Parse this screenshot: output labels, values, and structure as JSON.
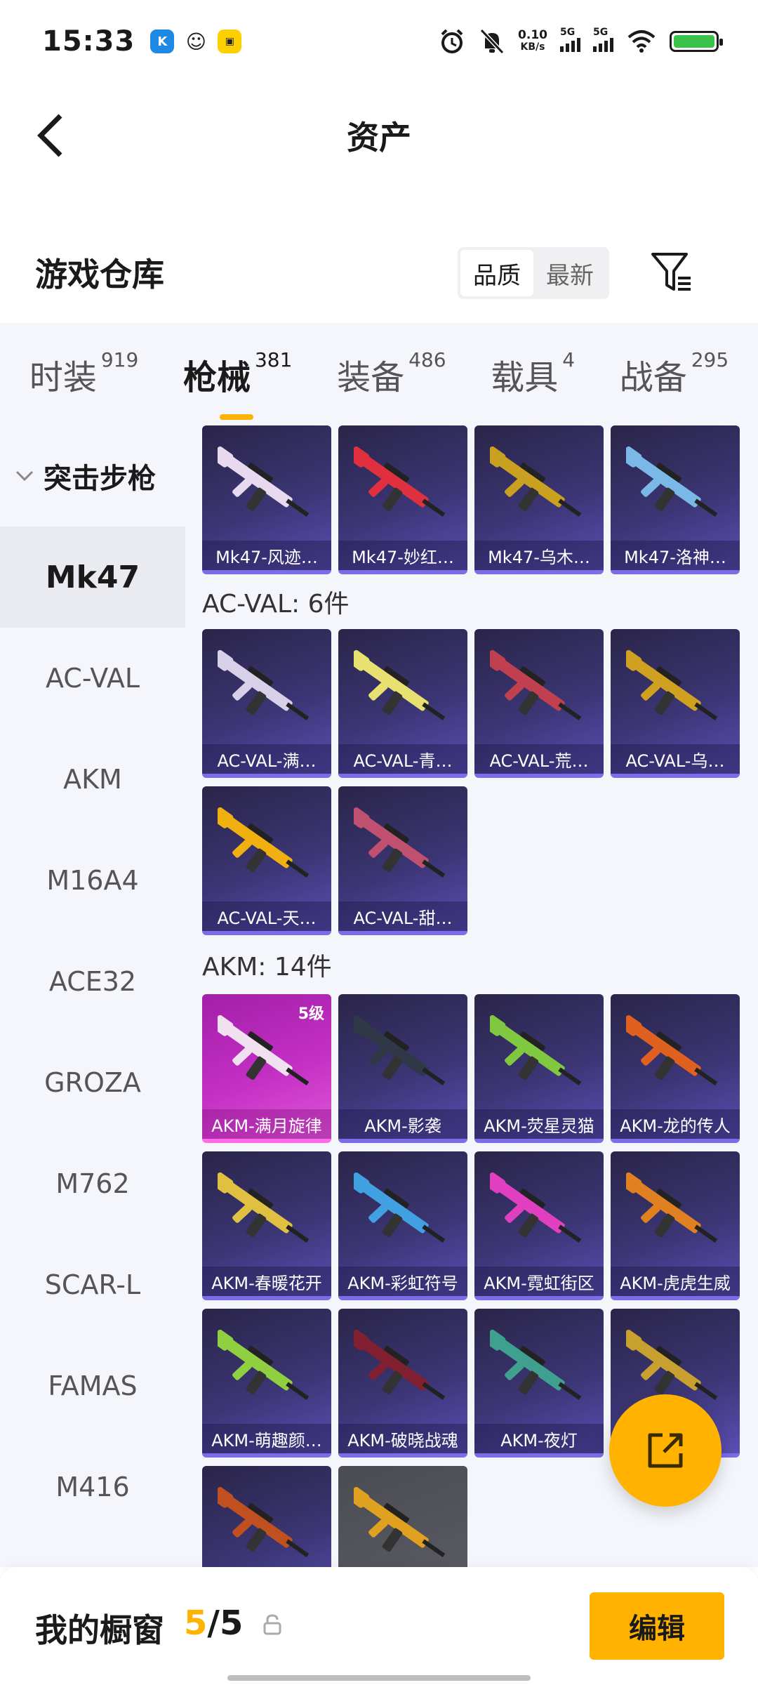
{
  "status_bar": {
    "time": "15:33",
    "net_speed_value": "0.10",
    "net_speed_unit": "KB/s",
    "signal_1": "5G",
    "signal_2": "5G",
    "battery": "100"
  },
  "header": {
    "title": "资产"
  },
  "warehouse": {
    "title": "游戏仓库",
    "sort_options": [
      "品质",
      "最新"
    ],
    "sort_selected": "品质"
  },
  "tabs": [
    {
      "label": "时装",
      "count": "919"
    },
    {
      "label": "枪械",
      "count": "381",
      "active": true
    },
    {
      "label": "装备",
      "count": "486"
    },
    {
      "label": "载具",
      "count": "4"
    },
    {
      "label": "战备",
      "count": "295"
    }
  ],
  "sidebar": {
    "group": "突击步枪",
    "items": [
      "Mk47",
      "AC-VAL",
      "AKM",
      "M16A4",
      "ACE32",
      "GROZA",
      "M762",
      "SCAR-L",
      "FAMAS",
      "M416"
    ],
    "active": "Mk47"
  },
  "grid": {
    "mk47": [
      "Mk47-风迹…",
      "Mk47-妙红…",
      "Mk47-乌木…",
      "Mk47-洛神…"
    ],
    "acval_header": "AC-VAL: 6件",
    "acval": [
      "AC-VAL-满…",
      "AC-VAL-青…",
      "AC-VAL-荒…",
      "AC-VAL-乌…",
      "AC-VAL-天…",
      "AC-VAL-甜…"
    ],
    "akm_header": "AKM: 14件",
    "akm_level": "5级",
    "akm": [
      "AKM-满月旋律",
      "AKM-影袭",
      "AKM-荧星灵猫",
      "AKM-龙的传人",
      "AKM-春暖花开",
      "AKM-彩虹符号",
      "AKM-霓虹街区",
      "AKM-虎虎生威",
      "AKM-萌趣颜…",
      "AKM-破晓战魂",
      "AKM-夜灯"
    ]
  },
  "bottom_bar": {
    "showcase_label": "我的橱窗",
    "showcase_current": "5",
    "showcase_sep": "/",
    "showcase_total": "5",
    "edit_label": "编辑"
  },
  "colors": {
    "accent": "#ffb300",
    "card_purple": "#3b3574",
    "card_pink": "#c42fc4"
  },
  "gun_colors": {
    "mk47": [
      "#e8d8f0",
      "#e03040",
      "#c9a020",
      "#7ab8e8"
    ],
    "acval": [
      "#d8d0e8",
      "#e8e070",
      "#c04050",
      "#d0a020",
      "#f0b010",
      "#c05070"
    ],
    "akm": [
      "#f0e0f0",
      "#303848",
      "#80c840",
      "#e06020",
      "#e0c040",
      "#40a0e0",
      "#e040c0",
      "#e08020",
      "#90d040",
      "#802030",
      "#40a090",
      "#c8a030",
      "#c05020",
      "#e0a020"
    ]
  }
}
